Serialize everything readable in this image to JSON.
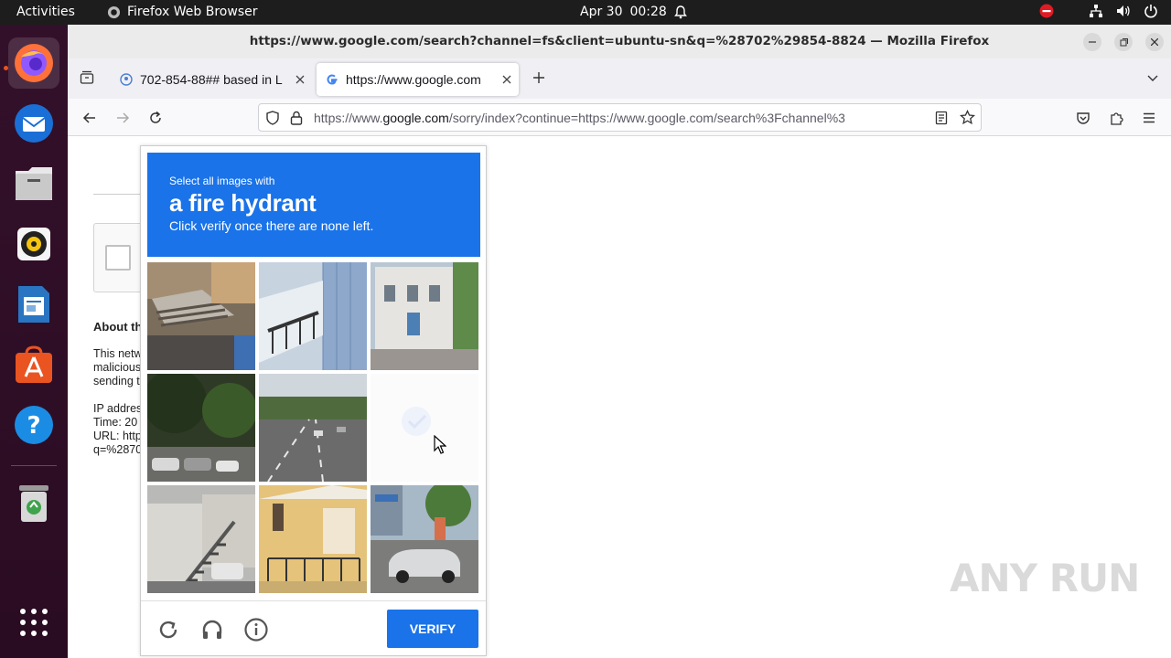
{
  "topbar": {
    "activities": "Activities",
    "app_name": "Firefox Web Browser",
    "date": "Apr 30",
    "time": "00:28"
  },
  "dock": {
    "items": [
      "firefox-icon",
      "thunderbird-icon",
      "files-icon",
      "rhythmbox-icon",
      "writer-icon",
      "app-center-icon",
      "help-icon",
      "trash-icon",
      "show-apps-icon"
    ]
  },
  "window": {
    "title": "https://www.google.com/search?channel=fs&client=ubuntu-sn&q=%28702%29854-8824 — Mozilla Firefox"
  },
  "tabs": [
    {
      "title": "702-854-88## based in L"
    },
    {
      "title": "https://www.google.com"
    }
  ],
  "urlbar": {
    "url_prefix": "https://www.",
    "url_domain": "google.com",
    "url_rest": "/sorry/index?continue=https://www.google.com/search%3Fchannel%3"
  },
  "page": {
    "about_heading": "About th",
    "para": [
      "This netw",
      "malicious",
      "sending t"
    ],
    "info": [
      "IP addres",
      "Time: 20",
      "URL: http",
      "q=%2870"
    ]
  },
  "captcha": {
    "line1": "Select all images with",
    "target": "a fire hydrant",
    "line3": "Click verify once there are none left.",
    "verify_label": "VERIFY",
    "tiles": [
      "stairs-ruins",
      "building-balcony",
      "house-street",
      "trees-parked-cars",
      "road-traffic",
      "blank-loading",
      "building-stairs",
      "yellow-building",
      "street-cars"
    ]
  },
  "watermark": "ANY RUN",
  "colors": {
    "captcha_blue": "#1a73e8",
    "dock_bg": "#2c0a20",
    "topbar_bg": "#1d1d1d"
  }
}
